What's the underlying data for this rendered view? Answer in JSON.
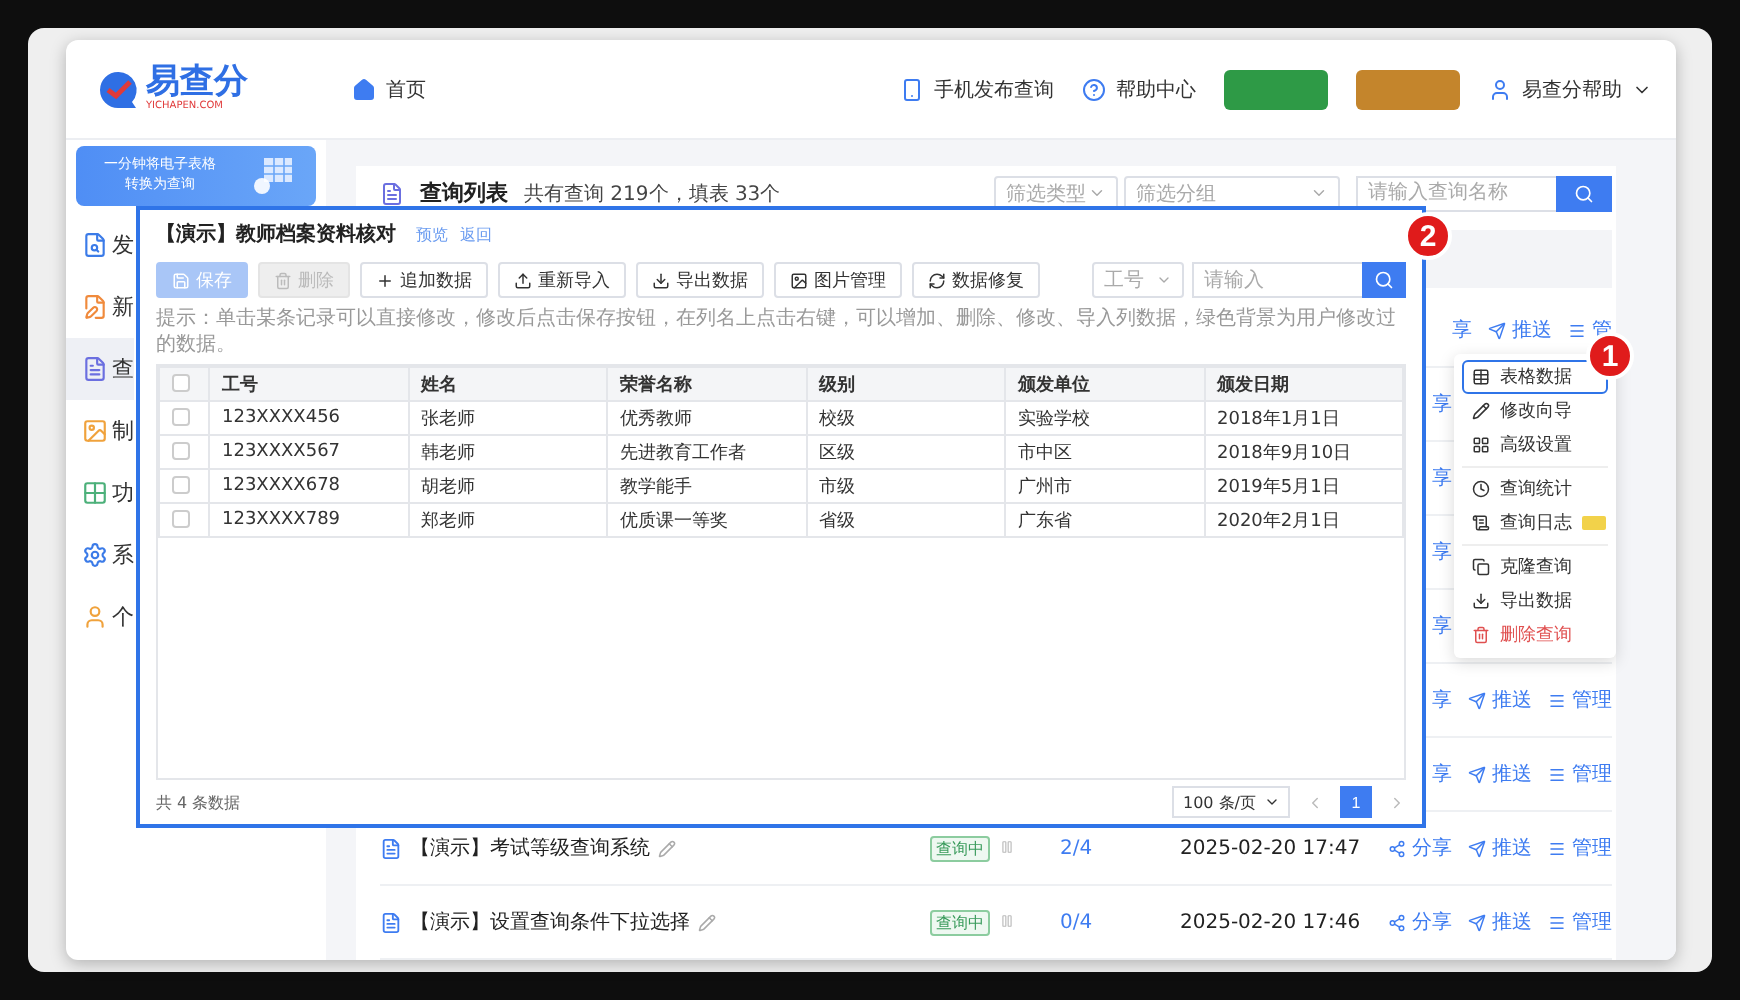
{
  "header": {
    "logo": {
      "name": "易查分",
      "domain": "YICHAPEN.COM"
    },
    "home": "首页",
    "links": [
      "手机发布查询",
      "帮助中心"
    ],
    "action_buttons": [
      {
        "color": "#2e9a46"
      },
      {
        "color": "#c4852c"
      }
    ],
    "user": "易查分帮助"
  },
  "sidebar": {
    "promo": [
      "一分钟将电子表格",
      "转换为查询"
    ],
    "items": [
      {
        "label": "发",
        "color": "#3b7be8",
        "selected": false
      },
      {
        "label": "新",
        "color": "#f08a3c",
        "selected": false
      },
      {
        "label": "查",
        "color": "#6b6fe0",
        "selected": true
      },
      {
        "label": "制",
        "color": "#f0a23c",
        "selected": false
      },
      {
        "label": "功",
        "color": "#4cb07a",
        "selected": false
      },
      {
        "label": "系",
        "color": "#3b7be8",
        "selected": false
      },
      {
        "label": "个",
        "color": "#f0a23c",
        "selected": false
      }
    ]
  },
  "list": {
    "title": "查询列表",
    "summary": "共有查询 219个，填表 33个",
    "filters": [
      {
        "placeholder": "筛选类型"
      },
      {
        "placeholder": "筛选分组"
      }
    ],
    "search": {
      "placeholder": "请输入查询名称"
    },
    "rows": [
      {
        "kind": "covered",
        "share": "享",
        "push": "推送",
        "manage": "管"
      },
      {
        "kind": "covered",
        "share": "享"
      },
      {
        "kind": "covered",
        "share": "享"
      },
      {
        "kind": "covered",
        "share": "享"
      },
      {
        "kind": "covered",
        "share": "享"
      },
      {
        "kind": "covered",
        "share": "享",
        "push": "推送",
        "manage": "管理"
      },
      {
        "kind": "covered",
        "share": "享",
        "push": "推送",
        "manage": "管理"
      },
      {
        "kind": "full",
        "title": "【演示】考试等级查询系统",
        "status": "查询中",
        "count": "2/4",
        "date": "2025-02-20 17:47",
        "share": "分享",
        "push": "推送",
        "manage": "管理"
      },
      {
        "kind": "full",
        "title": "【演示】设置查询条件下拉选择",
        "status": "查询中",
        "count": "0/4",
        "date": "2025-02-20 17:46",
        "share": "分享",
        "push": "推送",
        "manage": "管理"
      }
    ]
  },
  "modal": {
    "title": "【演示】教师档案资料核对",
    "links": [
      "预览",
      "返回"
    ],
    "toolbar": [
      {
        "label": "保存",
        "kind": "primary",
        "disabled": true
      },
      {
        "label": "删除",
        "kind": "plain",
        "disabled": true
      },
      {
        "label": "追加数据",
        "kind": "plain",
        "disabled": false
      },
      {
        "label": "重新导入",
        "kind": "plain",
        "disabled": false
      },
      {
        "label": "导出数据",
        "kind": "plain",
        "disabled": false
      },
      {
        "label": "图片管理",
        "kind": "plain",
        "disabled": false
      },
      {
        "label": "数据修复",
        "kind": "plain",
        "disabled": false
      }
    ],
    "search_field": {
      "value": "工号",
      "placeholder": "请输入"
    },
    "hint": "提示：单击某条记录可以直接修改，修改后点击保存按钮，在列名上点击右键，可以增加、删除、修改、导入列数据，绿色背景为用户修改过的数据。",
    "select_all": {
      "checked": false
    },
    "columns": [
      "工号",
      "姓名",
      "荣誉名称",
      "级别",
      "颁发单位",
      "颁发日期"
    ],
    "rows": [
      {
        "checked": false,
        "cells": [
          "123XXXX456",
          "张老师",
          "优秀教师",
          "校级",
          "实验学校",
          "2018年1月1日"
        ]
      },
      {
        "checked": false,
        "cells": [
          "123XXXX567",
          "韩老师",
          "先进教育工作者",
          "区级",
          "市中区",
          "2018年9月10日"
        ]
      },
      {
        "checked": false,
        "cells": [
          "123XXXX678",
          "胡老师",
          "教学能手",
          "市级",
          "广州市",
          "2019年5月1日"
        ]
      },
      {
        "checked": false,
        "cells": [
          "123XXXX789",
          "郑老师",
          "优质课一等奖",
          "省级",
          "广东省",
          "2020年2月1日"
        ]
      }
    ],
    "total": "共 4 条数据",
    "page_size": "100 条/页",
    "pages": [
      {
        "label": "1",
        "selected": true
      }
    ]
  },
  "menu": {
    "items": [
      {
        "kind": "item",
        "label": "表格数据",
        "selected": true
      },
      {
        "kind": "item",
        "label": "修改向导",
        "selected": false
      },
      {
        "kind": "item",
        "label": "高级设置",
        "selected": false
      },
      {
        "kind": "divider"
      },
      {
        "kind": "item",
        "label": "查询统计",
        "selected": false
      },
      {
        "kind": "tagged",
        "label": "查询日志",
        "selected": false
      },
      {
        "kind": "divider"
      },
      {
        "kind": "item",
        "label": "克隆查询",
        "selected": false
      },
      {
        "kind": "item",
        "label": "导出数据",
        "selected": false
      },
      {
        "kind": "danger",
        "label": "删除查询",
        "selected": false
      }
    ]
  },
  "markers": [
    "1",
    "2"
  ]
}
